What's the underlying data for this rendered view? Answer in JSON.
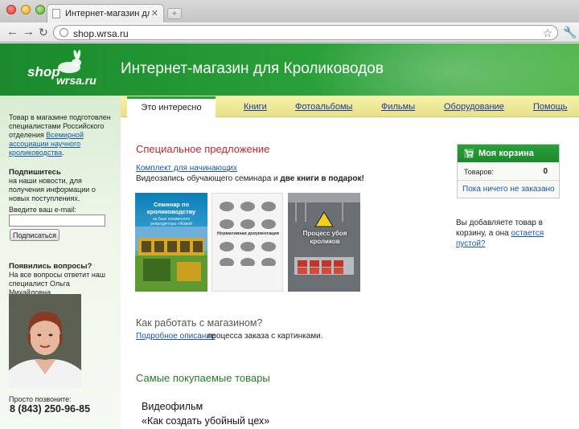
{
  "browser": {
    "tab_title": "Интернет-магазин для Кролик",
    "tab_close": "✕",
    "new_tab": "+",
    "url": "shop.wrsa.ru"
  },
  "header": {
    "logo_shop": "shop",
    "logo_domain": "wrsa.ru",
    "title": "Интернет-магазин для Кролиководов",
    "accent_color": "#2aa03a"
  },
  "sidebar": {
    "about_1": "Товар в магазине подготовлен специалистами Российского отделения",
    "about_link": "Всемирной ассоциации научного кролиководства",
    "about_end": ".",
    "subscribe_title": "Подпишитесь",
    "subscribe_text": "на наши новости, для получения информации о новых поступлениях.",
    "email_label": "Введите ваш e-mail:",
    "email_value": "",
    "subscribe_button": "Подписаться",
    "questions_title": "Появились вопросы?",
    "questions_text": "На все вопросы ответит наш специалист Ольга Михайловна",
    "call_text": "Просто позвоните:",
    "phone": "8 (843) 250-96-85"
  },
  "nav": {
    "active": "Это интересно",
    "items": [
      "Книги",
      "Фотоальбомы",
      "Фильмы",
      "Оборудование",
      "Помощь"
    ]
  },
  "main": {
    "special_title": "Специальное предложение",
    "kit_link": "Комплект для начинающих",
    "kit_colon": ":",
    "kit_desc_1": "Видеозапись обучающего семинара и ",
    "kit_desc_bold": "две книги в подарок!",
    "book1_title": "Семинар по кролиководству",
    "book1_sub": "на базе племенного репродуктора «Живой нордистан»",
    "book2_title": "Нормативная документация",
    "book3_title": "Процесс убоя кроликов",
    "how_title": "Как работать с магазином?",
    "how_link": "Подробное описание",
    "how_rest": " процесса заказа с картинками.",
    "popular_title": "Самые покупаемые товары",
    "video_line1": "Видеофильм",
    "video_line2": "«Как создать убойный цех»"
  },
  "cart": {
    "title": "Моя корзина",
    "items_label": "Товаров:",
    "items_count": "0",
    "empty_text": "Пока ничего не заказано",
    "note_1": "Вы добавляете товар в корзину, а она ",
    "note_link": "остается пустой?"
  }
}
